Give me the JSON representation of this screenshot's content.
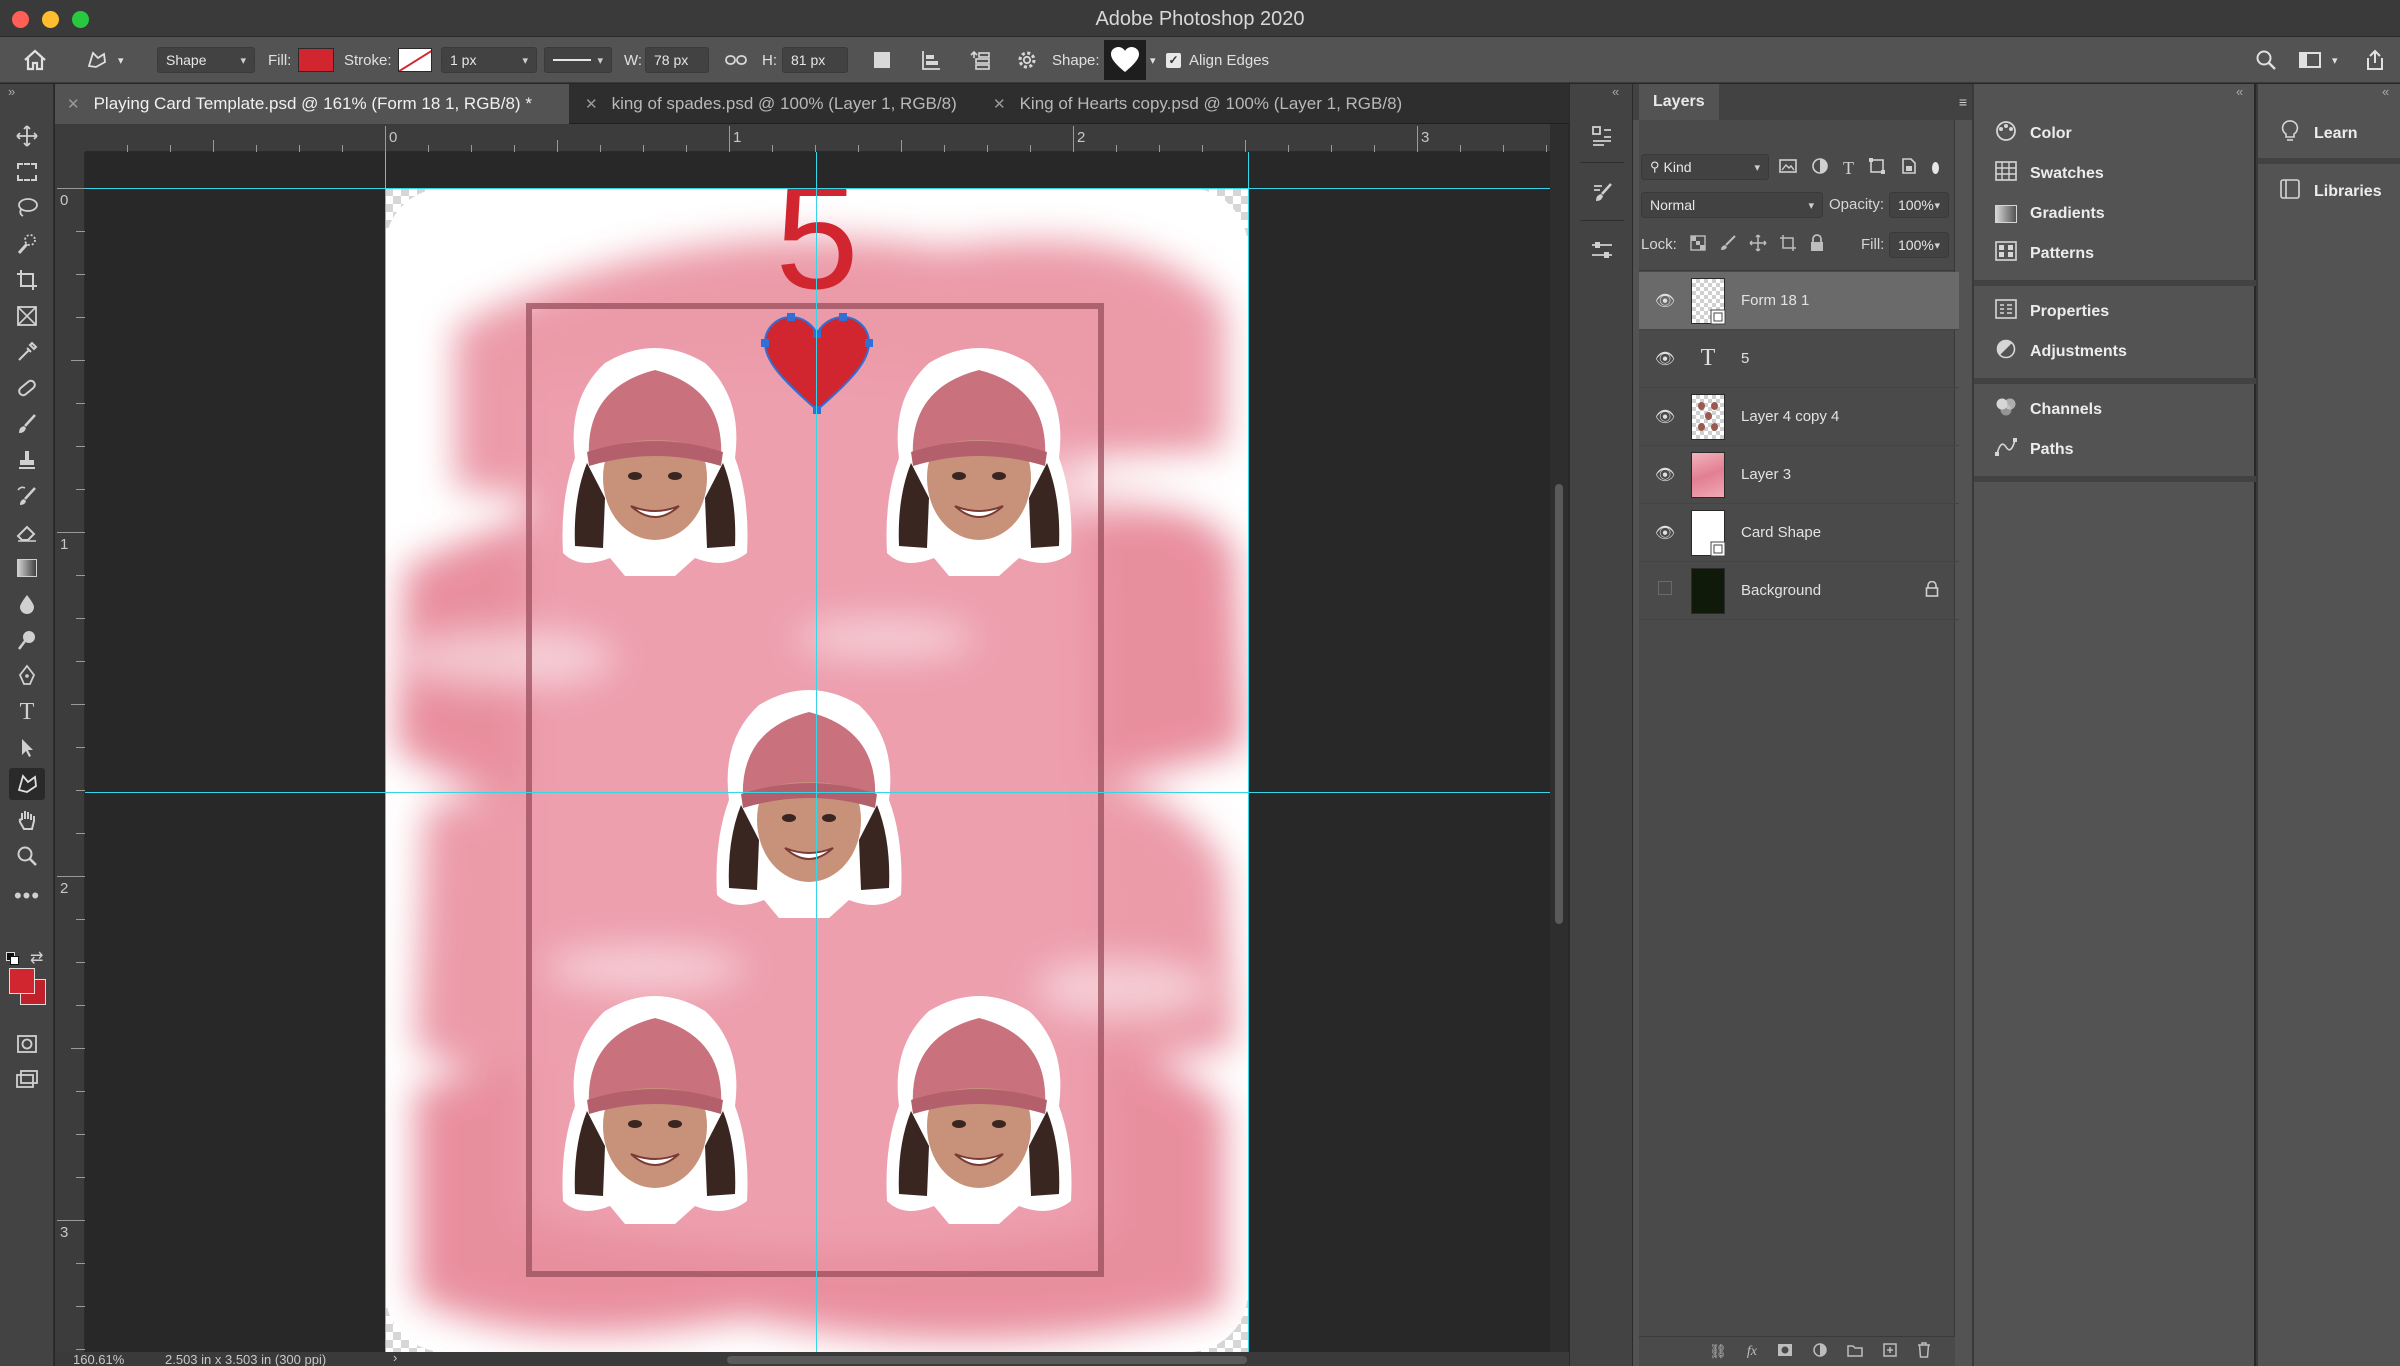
{
  "app": {
    "title": "Adobe Photoshop 2020"
  },
  "options_bar": {
    "mode": "Shape",
    "fill_label": "Fill:",
    "fill_color": "#d1262f",
    "stroke_label": "Stroke:",
    "stroke_width": "1 px",
    "w_label": "W:",
    "w_value": "78 px",
    "h_label": "H:",
    "h_value": "81 px",
    "shape_label": "Shape:",
    "align_edges": "Align Edges"
  },
  "tabs": [
    {
      "label": "Playing Card Template.psd @ 161% (Form 18 1, RGB/8) *"
    },
    {
      "label": "king of spades.psd @ 100% (Layer 1, RGB/8)"
    },
    {
      "label": "King of Hearts copy.psd @ 100% (Layer 1, RGB/8)"
    }
  ],
  "rulers": {
    "h": [
      "0",
      "1",
      "2",
      "3"
    ],
    "v": [
      "0",
      "1",
      "2",
      "3"
    ]
  },
  "card": {
    "rank": "5",
    "suit_color": "#d1262f",
    "background_tint": "#e8899a"
  },
  "status": {
    "zoom": "160.61%",
    "doc_size": "2.503 in x 3.503 in (300 ppi)"
  },
  "layers_panel": {
    "title": "Layers",
    "filter": "Kind",
    "blend_mode": "Normal",
    "opacity_label": "Opacity:",
    "opacity": "100%",
    "lock_label": "Lock:",
    "fill_label": "Fill:",
    "fill": "100%",
    "layers": [
      {
        "name": "Form 18 1",
        "visible": true,
        "selected": true
      },
      {
        "name": "5",
        "visible": true,
        "selected": false
      },
      {
        "name": "Layer 4 copy 4",
        "visible": true,
        "selected": false
      },
      {
        "name": "Layer 3",
        "visible": true,
        "selected": false
      },
      {
        "name": "Card Shape",
        "visible": true,
        "selected": false
      },
      {
        "name": "Background",
        "visible": false,
        "selected": false
      }
    ]
  },
  "side_panels": {
    "group1": [
      "Color",
      "Swatches",
      "Gradients",
      "Patterns"
    ],
    "group2": [
      "Properties",
      "Adjustments"
    ],
    "group3": [
      "Channels",
      "Paths"
    ]
  },
  "right_panels": [
    "Learn",
    "Libraries"
  ],
  "colors": {
    "foreground": "#d1262f",
    "background": "#c0202a",
    "guide": "#36d6e8"
  }
}
